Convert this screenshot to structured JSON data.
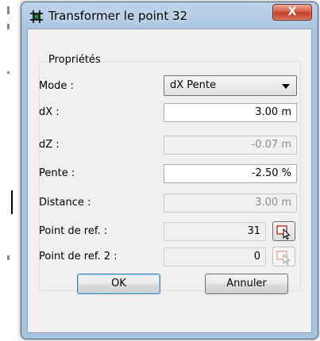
{
  "window": {
    "title": "Transformer le point 32",
    "close_label": "X"
  },
  "group": {
    "label": "Propriétés"
  },
  "fields": {
    "mode": {
      "label": "Mode :",
      "value": "dX Pente"
    },
    "dx": {
      "label": "dX :",
      "value": "3.00 m"
    },
    "dz": {
      "label": "dZ :",
      "value": "-0.07 m"
    },
    "pente": {
      "label": "Pente :",
      "value": "-2.50 %"
    },
    "distance": {
      "label": "Distance :",
      "value": "3.00 m"
    },
    "ref1": {
      "label": "Point de ref. :",
      "value": "31"
    },
    "ref2": {
      "label": "Point de ref. 2 :",
      "value": "0"
    }
  },
  "buttons": {
    "ok": "OK",
    "cancel": "Annuler"
  },
  "icons": {
    "app": "transform-point-icon",
    "pick": "pick-point-cursor-icon"
  },
  "colors": {
    "title_bar": "#a9c3df",
    "close_button": "#c23b22",
    "client_bg": "#f0f0f0"
  }
}
